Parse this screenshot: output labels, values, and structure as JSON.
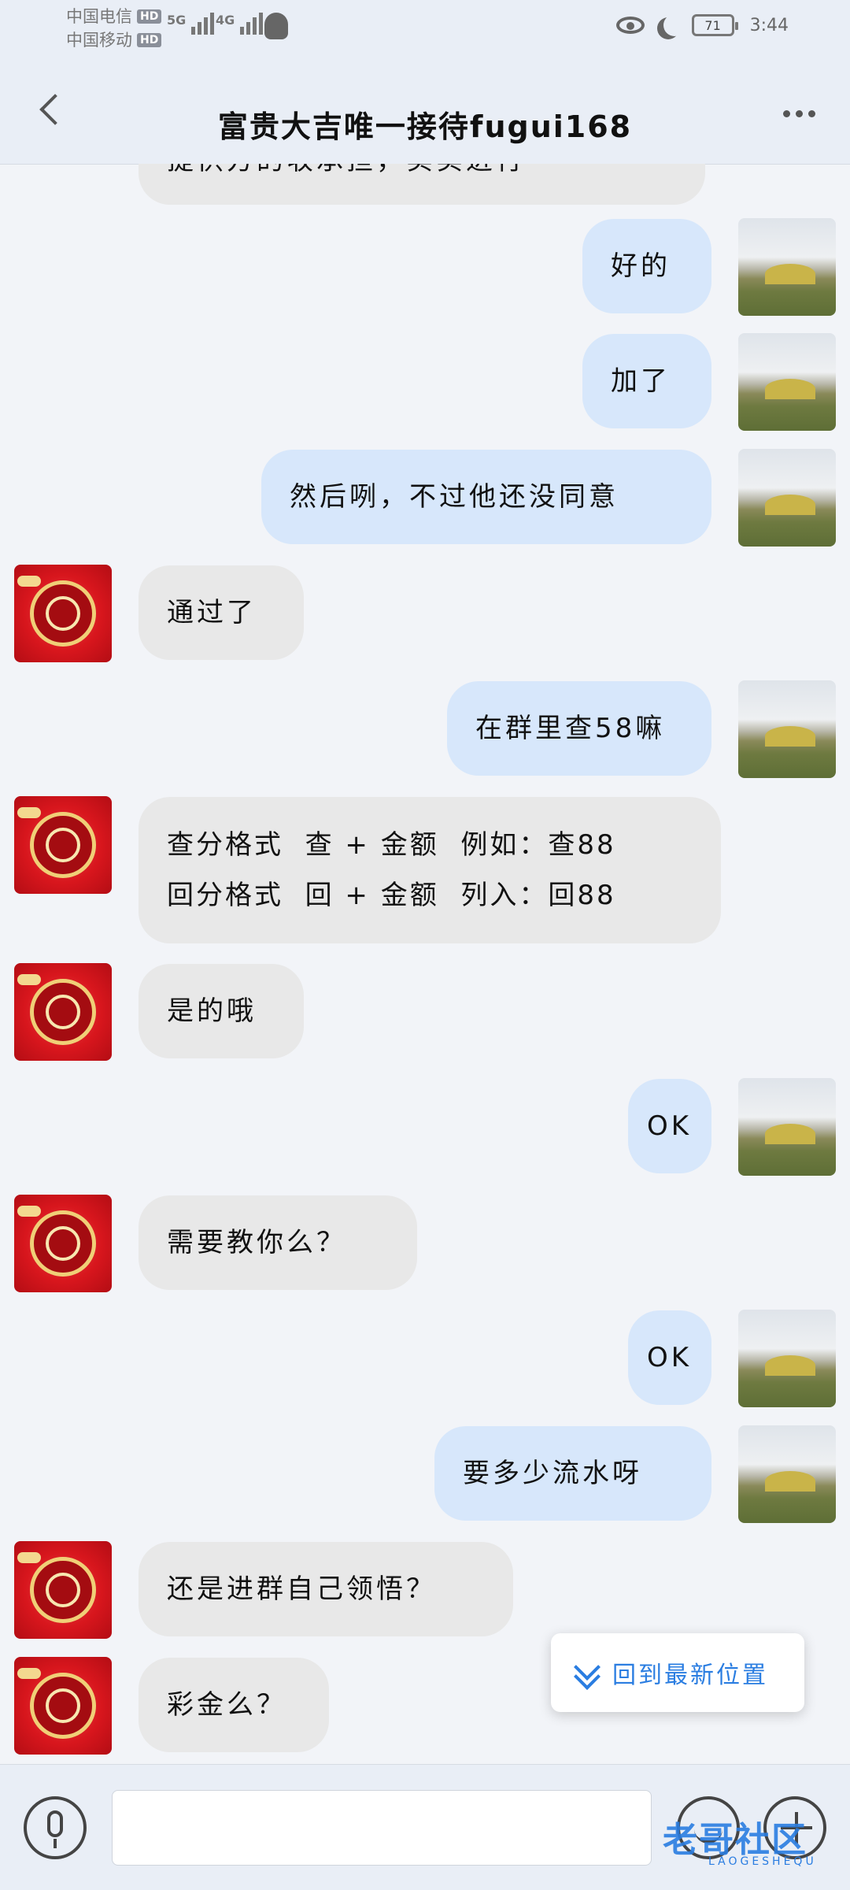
{
  "status_bar": {
    "carrier_1": "中国电信",
    "carrier_2": "中国移动",
    "hd_badge": "HD",
    "net_1": "5G",
    "net_2": "4G",
    "battery": "71",
    "time": "3:44"
  },
  "header": {
    "title": "富贵大吉唯一接待fugui168"
  },
  "messages": [
    {
      "side": "in",
      "text": "提供方的收承担，实实进行"
    },
    {
      "side": "out",
      "text": "好的"
    },
    {
      "side": "out",
      "text": "加了"
    },
    {
      "side": "out",
      "text": "然后咧，不过他还没同意"
    },
    {
      "side": "in",
      "text": "通过了"
    },
    {
      "side": "out",
      "text": "在群里查58嘛"
    },
    {
      "side": "in",
      "lines": [
        "查分格式  查 + 金额  例如：查88",
        "回分格式  回 + 金额  列入：回88"
      ]
    },
    {
      "side": "in",
      "text": "是的哦"
    },
    {
      "side": "out",
      "text": "OK"
    },
    {
      "side": "in",
      "text": "需要教你么？"
    },
    {
      "side": "out",
      "text": "OK"
    },
    {
      "side": "out",
      "text": "要多少流水呀"
    },
    {
      "side": "in",
      "text": "还是进群自己领悟？"
    },
    {
      "side": "in",
      "text": "彩金么？"
    }
  ],
  "jump_latest": {
    "label": "回到最新位置"
  },
  "input": {
    "placeholder": ""
  },
  "watermark": {
    "text": "老哥社区",
    "sub": "LAOGESHEQU"
  }
}
